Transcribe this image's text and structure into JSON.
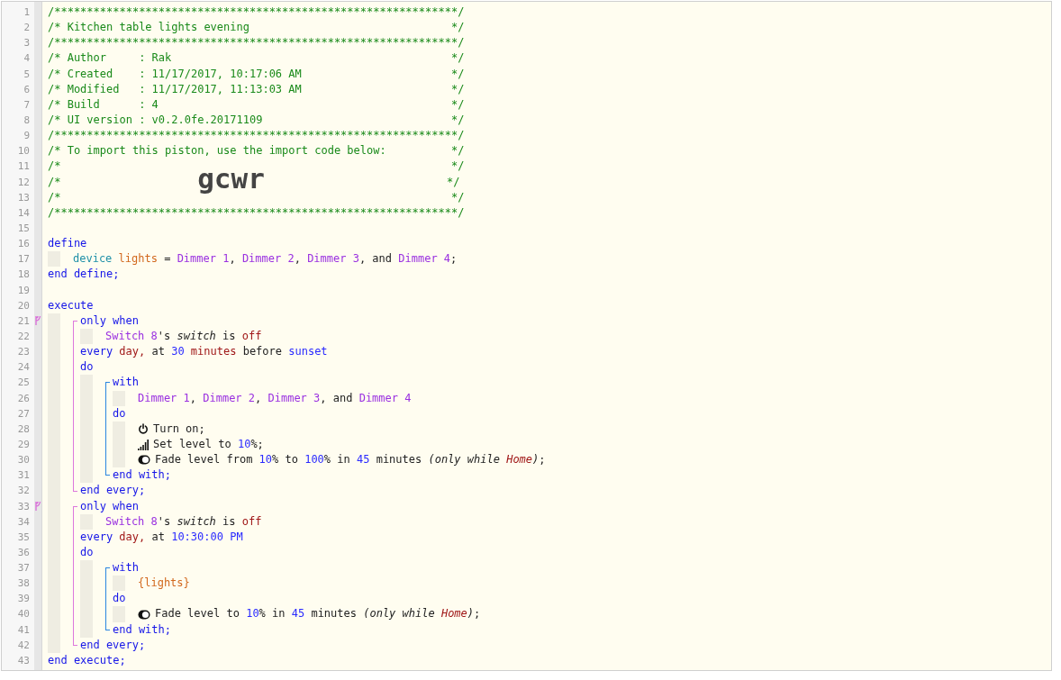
{
  "lines": [
    {
      "kind": "line",
      "num": "1",
      "tokens": [
        {
          "kind": "comment",
          "text": "/**************************************************************/"
        }
      ]
    },
    {
      "kind": "line",
      "num": "2",
      "tokens": [
        {
          "kind": "comment",
          "text": "/* Kitchen table lights evening                               */"
        }
      ]
    },
    {
      "kind": "line",
      "num": "3",
      "tokens": [
        {
          "kind": "comment",
          "text": "/**************************************************************/"
        }
      ]
    },
    {
      "kind": "line",
      "num": "4",
      "tokens": [
        {
          "kind": "comment",
          "text": "/* Author     : Rak                                           */"
        }
      ]
    },
    {
      "kind": "line",
      "num": "5",
      "tokens": [
        {
          "kind": "comment",
          "text": "/* Created    : 11/17/2017, 10:17:06 AM                       */"
        }
      ]
    },
    {
      "kind": "line",
      "num": "6",
      "tokens": [
        {
          "kind": "comment",
          "text": "/* Modified   : 11/17/2017, 11:13:03 AM                       */"
        }
      ]
    },
    {
      "kind": "line",
      "num": "7",
      "tokens": [
        {
          "kind": "comment",
          "text": "/* Build      : 4                                             */"
        }
      ]
    },
    {
      "kind": "line",
      "num": "8",
      "tokens": [
        {
          "kind": "comment",
          "text": "/* UI version : v0.2.0fe.20171109                             */"
        }
      ]
    },
    {
      "kind": "line",
      "num": "9",
      "tokens": [
        {
          "kind": "comment",
          "text": "/**************************************************************/"
        }
      ]
    },
    {
      "kind": "line",
      "num": "10",
      "tokens": [
        {
          "kind": "comment",
          "text": "/* To import this piston, use the import code below:          */"
        }
      ]
    },
    {
      "kind": "line",
      "num": "11",
      "tokens": [
        {
          "kind": "comment",
          "text": "/*                                                            */"
        }
      ]
    },
    {
      "kind": "line",
      "num": "12",
      "tokens": [
        {
          "kind": "comment",
          "text": "/*                     "
        },
        {
          "kind": "import_code",
          "text": "gcwr"
        },
        {
          "kind": "comment",
          "text": "                            */"
        }
      ]
    },
    {
      "kind": "line",
      "num": "13",
      "tokens": [
        {
          "kind": "comment",
          "text": "/*                                                            */"
        }
      ]
    },
    {
      "kind": "line",
      "num": "14",
      "tokens": [
        {
          "kind": "comment",
          "text": "/**************************************************************/"
        }
      ]
    },
    {
      "kind": "line",
      "num": "15"
    },
    {
      "kind": "line",
      "num": "16",
      "tokens": [
        {
          "kind": "keyword",
          "text": "define"
        }
      ],
      "children": [
        {
          "kind": "line",
          "num": "17",
          "tokens": [
            {
              "kind": "type",
              "text": "device "
            },
            {
              "kind": "variable",
              "text": "lights"
            },
            {
              "kind": "text",
              "text": " = "
            },
            {
              "kind": "device",
              "text": "Dimmer 1"
            },
            {
              "kind": "text",
              "text": ", "
            },
            {
              "kind": "device",
              "text": "Dimmer 2"
            },
            {
              "kind": "text",
              "text": ", "
            },
            {
              "kind": "device",
              "text": "Dimmer 3"
            },
            {
              "kind": "text",
              "text": ", and "
            },
            {
              "kind": "device",
              "text": "Dimmer 4"
            },
            {
              "kind": "text",
              "text": ";"
            }
          ]
        }
      ]
    },
    {
      "kind": "line",
      "num": "18",
      "tokens": [
        {
          "kind": "keyword",
          "text": "end define;"
        }
      ]
    },
    {
      "kind": "line",
      "num": "19"
    },
    {
      "kind": "line",
      "num": "20",
      "tokens": [
        {
          "kind": "keyword",
          "text": "execute"
        }
      ],
      "children": [
        {
          "kind": "every",
          "trigger": true,
          "items": [
            {
              "kind": "line",
              "num": "21",
              "tokens": [
                {
                  "kind": "keyword",
                  "text": "only when"
                }
              ],
              "children": [
                {
                  "kind": "line",
                  "num": "22",
                  "tokens": [
                    {
                      "kind": "device",
                      "text": "Switch 8"
                    },
                    {
                      "kind": "text",
                      "text": "'s "
                    },
                    {
                      "kind": "italic",
                      "text": "switch"
                    },
                    {
                      "kind": "text",
                      "text": " is "
                    },
                    {
                      "kind": "unit",
                      "text": "off"
                    }
                  ]
                }
              ]
            },
            {
              "kind": "line",
              "num": "23",
              "tokens": [
                {
                  "kind": "keyword",
                  "text": "every "
                },
                {
                  "kind": "unit",
                  "text": "day,"
                },
                {
                  "kind": "text",
                  "text": " at "
                },
                {
                  "kind": "value",
                  "text": "30 "
                },
                {
                  "kind": "unit",
                  "text": "minutes"
                },
                {
                  "kind": "text",
                  "text": " before "
                },
                {
                  "kind": "value",
                  "text": "sunset"
                }
              ]
            },
            {
              "kind": "line",
              "num": "24",
              "tokens": [
                {
                  "kind": "keyword",
                  "text": "do"
                }
              ],
              "children": [
                {
                  "kind": "with",
                  "trigger": false,
                  "items": [
                    {
                      "kind": "line",
                      "num": "25",
                      "tokens": [
                        {
                          "kind": "keyword",
                          "text": "with"
                        }
                      ],
                      "children": [
                        {
                          "kind": "line",
                          "num": "26",
                          "tokens": [
                            {
                              "kind": "device",
                              "text": "Dimmer 1"
                            },
                            {
                              "kind": "text",
                              "text": ", "
                            },
                            {
                              "kind": "device",
                              "text": "Dimmer 2"
                            },
                            {
                              "kind": "text",
                              "text": ", "
                            },
                            {
                              "kind": "device",
                              "text": "Dimmer 3"
                            },
                            {
                              "kind": "text",
                              "text": ", and "
                            },
                            {
                              "kind": "device",
                              "text": "Dimmer 4"
                            }
                          ]
                        }
                      ]
                    },
                    {
                      "kind": "line",
                      "num": "27",
                      "tokens": [
                        {
                          "kind": "keyword",
                          "text": "do"
                        }
                      ],
                      "children": [
                        {
                          "kind": "power_action",
                          "num": "28",
                          "tokens": [
                            {
                              "kind": "text",
                              "text": "Turn on;"
                            }
                          ]
                        },
                        {
                          "kind": "level_action",
                          "num": "29",
                          "tokens": [
                            {
                              "kind": "text",
                              "text": "Set level to "
                            },
                            {
                              "kind": "value",
                              "text": "10"
                            },
                            {
                              "kind": "text",
                              "text": "%;"
                            }
                          ]
                        },
                        {
                          "kind": "fade_action",
                          "num": "30",
                          "tokens": [
                            {
                              "kind": "text",
                              "text": "Fade level from "
                            },
                            {
                              "kind": "value",
                              "text": "10"
                            },
                            {
                              "kind": "text",
                              "text": "% to "
                            },
                            {
                              "kind": "value",
                              "text": "100"
                            },
                            {
                              "kind": "text",
                              "text": "% in "
                            },
                            {
                              "kind": "value",
                              "text": "45"
                            },
                            {
                              "kind": "text",
                              "text": " minutes "
                            },
                            {
                              "kind": "italic",
                              "text": "(only while "
                            },
                            {
                              "kind": "special",
                              "text": "Home"
                            },
                            {
                              "kind": "italic",
                              "text": ")"
                            },
                            {
                              "kind": "text",
                              "text": ";"
                            }
                          ]
                        }
                      ]
                    },
                    {
                      "kind": "line",
                      "num": "31",
                      "tokens": [
                        {
                          "kind": "keyword",
                          "text": "end with;"
                        }
                      ]
                    }
                  ]
                }
              ]
            },
            {
              "kind": "line",
              "num": "32",
              "tokens": [
                {
                  "kind": "keyword",
                  "text": "end every;"
                }
              ]
            }
          ]
        },
        {
          "kind": "every",
          "trigger": true,
          "items": [
            {
              "kind": "line",
              "num": "33",
              "tokens": [
                {
                  "kind": "keyword",
                  "text": "only when"
                }
              ],
              "children": [
                {
                  "kind": "line",
                  "num": "34",
                  "tokens": [
                    {
                      "kind": "device",
                      "text": "Switch 8"
                    },
                    {
                      "kind": "text",
                      "text": "'s "
                    },
                    {
                      "kind": "italic",
                      "text": "switch"
                    },
                    {
                      "kind": "text",
                      "text": " is "
                    },
                    {
                      "kind": "unit",
                      "text": "off"
                    }
                  ]
                }
              ]
            },
            {
              "kind": "line",
              "num": "35",
              "tokens": [
                {
                  "kind": "keyword",
                  "text": "every "
                },
                {
                  "kind": "unit",
                  "text": "day,"
                },
                {
                  "kind": "text",
                  "text": " at "
                },
                {
                  "kind": "value",
                  "text": "10:30:00 PM"
                }
              ]
            },
            {
              "kind": "line",
              "num": "36",
              "tokens": [
                {
                  "kind": "keyword",
                  "text": "do"
                }
              ],
              "children": [
                {
                  "kind": "with",
                  "trigger": false,
                  "items": [
                    {
                      "kind": "line",
                      "num": "37",
                      "tokens": [
                        {
                          "kind": "keyword",
                          "text": "with"
                        }
                      ],
                      "children": [
                        {
                          "kind": "line",
                          "num": "38",
                          "tokens": [
                            {
                              "kind": "variable",
                              "text": "{lights}"
                            }
                          ]
                        }
                      ]
                    },
                    {
                      "kind": "line",
                      "num": "39",
                      "tokens": [
                        {
                          "kind": "keyword",
                          "text": "do"
                        }
                      ],
                      "children": [
                        {
                          "kind": "fade_action",
                          "num": "40",
                          "tokens": [
                            {
                              "kind": "text",
                              "text": "Fade level to "
                            },
                            {
                              "kind": "value",
                              "text": "10"
                            },
                            {
                              "kind": "text",
                              "text": "% in "
                            },
                            {
                              "kind": "value",
                              "text": "45"
                            },
                            {
                              "kind": "text",
                              "text": " minutes "
                            },
                            {
                              "kind": "italic",
                              "text": "(only while "
                            },
                            {
                              "kind": "special",
                              "text": "Home"
                            },
                            {
                              "kind": "italic",
                              "text": ")"
                            },
                            {
                              "kind": "text",
                              "text": ";"
                            }
                          ]
                        }
                      ]
                    },
                    {
                      "kind": "line",
                      "num": "41",
                      "tokens": [
                        {
                          "kind": "keyword",
                          "text": "end with;"
                        }
                      ]
                    }
                  ]
                }
              ]
            },
            {
              "kind": "line",
              "num": "42",
              "tokens": [
                {
                  "kind": "keyword",
                  "text": "end every;"
                }
              ]
            }
          ]
        }
      ]
    },
    {
      "kind": "line",
      "num": "43",
      "tokens": [
        {
          "kind": "keyword",
          "text": "end execute;"
        }
      ]
    }
  ]
}
